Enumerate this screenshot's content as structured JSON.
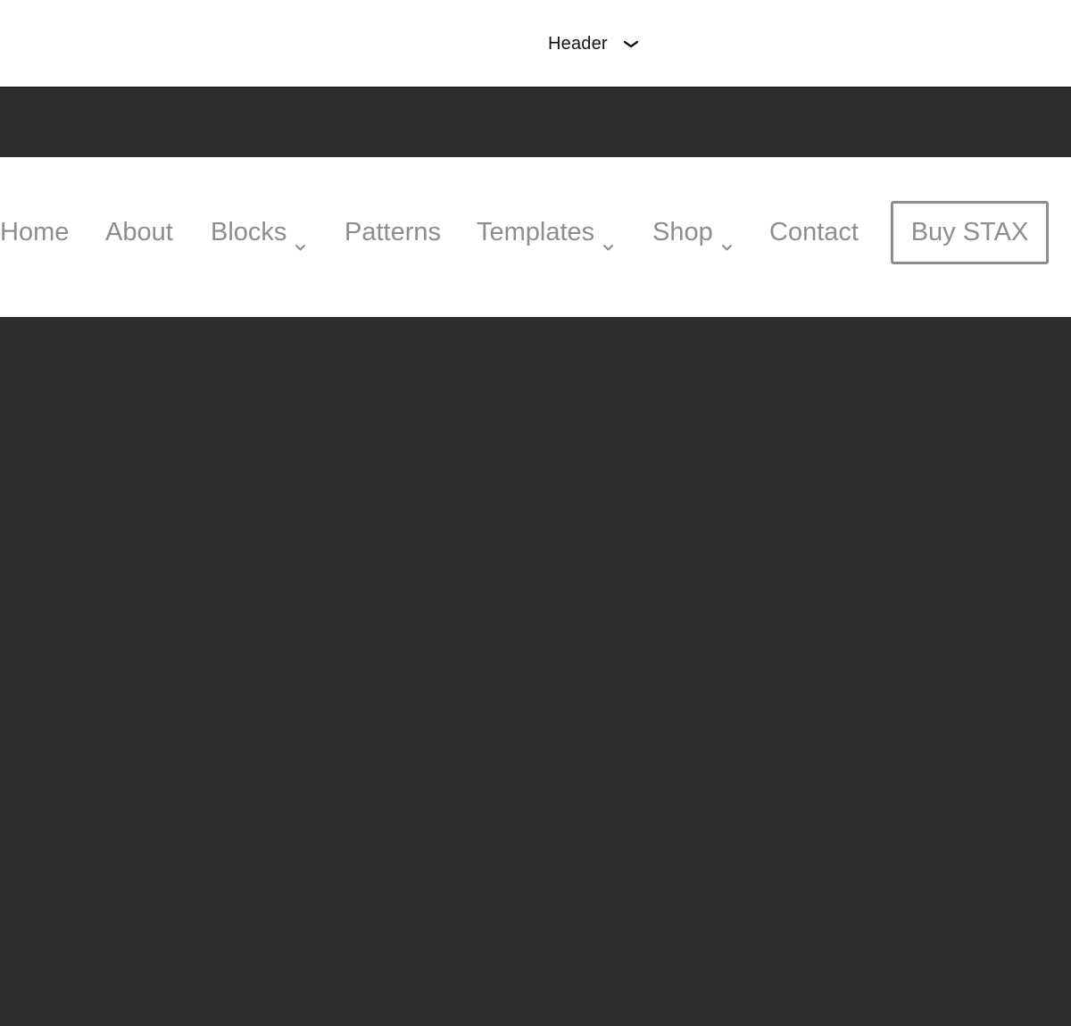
{
  "template_selector": {
    "label": "Header",
    "icon": "chevron-down-icon"
  },
  "navigation": {
    "items": [
      {
        "label": "Home",
        "has_submenu": false
      },
      {
        "label": "About",
        "has_submenu": false
      },
      {
        "label": "Blocks",
        "has_submenu": true
      },
      {
        "label": "Patterns",
        "has_submenu": false
      },
      {
        "label": "Templates",
        "has_submenu": true
      },
      {
        "label": "Shop",
        "has_submenu": true
      },
      {
        "label": "Contact",
        "has_submenu": false
      }
    ],
    "cta_label": "Buy STAX"
  },
  "colors": {
    "dark_background": "#2f2f2f",
    "nav_text": "#8d8d8d",
    "panel_background": "#ffffff"
  }
}
